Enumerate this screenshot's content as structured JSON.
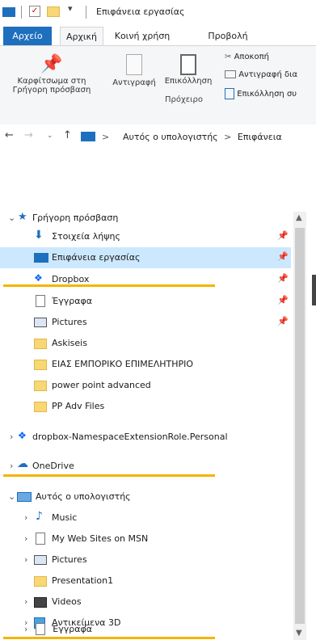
{
  "window": {
    "title": "Επιφάνεια εργασίας"
  },
  "ribbon": {
    "tabs": [
      "Αρχείο",
      "Αρχική",
      "Κοινή χρήση",
      "Προβολή"
    ],
    "pin_label_1": "Καρφίτσωμα στη",
    "pin_label_2": "Γρήγορη πρόσβαση",
    "copy_label": "Αντιγραφή",
    "paste_label": "Επικόλληση",
    "cut_label": "Αποκοπή",
    "copy_path_label": "Αντιγραφή δια",
    "paste_shortcut_label": "Επικόλληση συ",
    "group_label": "Πρόχειρο"
  },
  "address": {
    "crumb_1": "Αυτός ο υπολογιστής",
    "separator": ">",
    "crumb_2": "Επιφάνεια"
  },
  "tree": {
    "quick_access": "Γρήγορη πρόσβαση",
    "downloads": "Στοιχεία λήψης",
    "desktop": "Επιφάνεια εργασίας",
    "dropbox": "Dropbox",
    "documents": "Έγγραφα",
    "pictures": "Pictures",
    "askiseis": "Askiseis",
    "eias": "ΕΙΑΣ ΕΜΠΟΡΙΚΟ ΕΠΙΜΕΛΗΤΗΡΙΟ",
    "ppa": "power point advanced",
    "ppadv": "PP Adv Files",
    "dropbox_ns": "dropbox-NamespaceExtensionRole.Personal",
    "onedrive": "OneDrive",
    "this_pc": "Αυτός ο υπολογιστής",
    "music": "Music",
    "mywebsites": "My Web Sites on MSN",
    "pc_pictures": "Pictures",
    "presentation": "Presentation1",
    "videos": "Videos",
    "objects3d": "Αντικείμενα 3D",
    "pc_documents": "Έγγραφα"
  },
  "colors": {
    "accent": "#1e6fbe",
    "highlight": "#f5b400",
    "selection": "#cce8ff"
  }
}
